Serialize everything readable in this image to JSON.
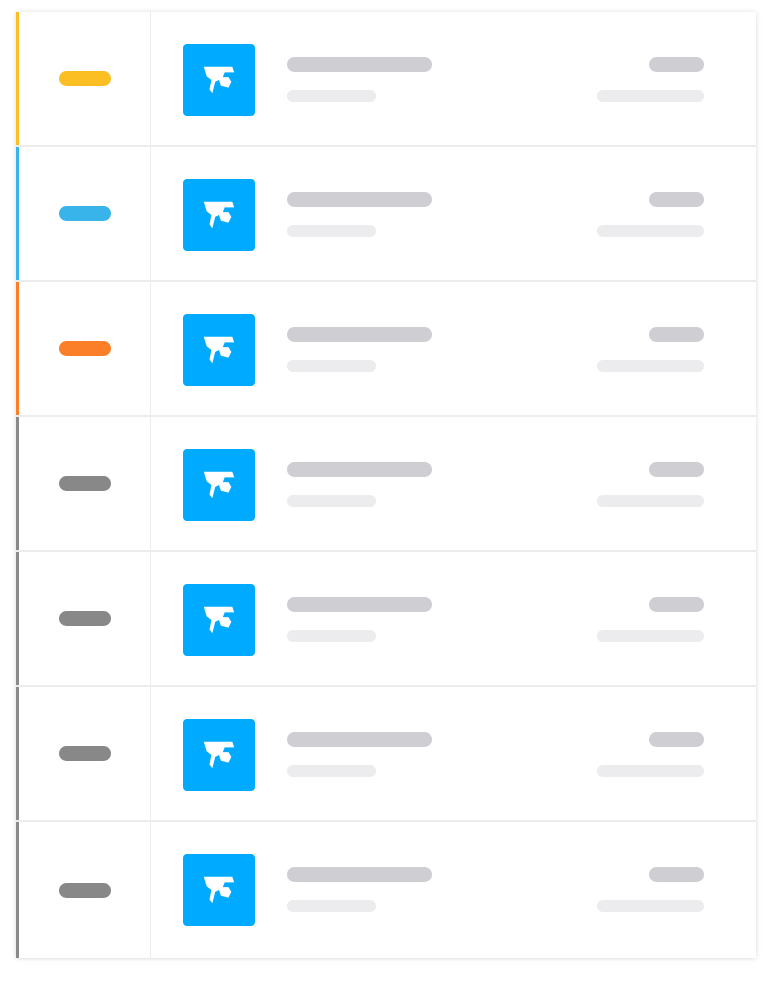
{
  "colors": {
    "icon_background": "#00aaff",
    "icon_glyph": "#ffffff",
    "placeholder_dark": "#cfcfd3",
    "placeholder_light": "#ececee"
  },
  "rows": [
    {
      "status": "yellow",
      "status_color": "#fbbf24",
      "accent_color": "#fbbf24",
      "icon": "app-logo-icon"
    },
    {
      "status": "blue",
      "status_color": "#38b4ea",
      "accent_color": "#38b4ea",
      "icon": "app-logo-icon"
    },
    {
      "status": "orange",
      "status_color": "#fb7e28",
      "accent_color": "#fb7e28",
      "icon": "app-logo-icon"
    },
    {
      "status": "gray",
      "status_color": "#888888",
      "accent_color": "#8a8a8a",
      "icon": "app-logo-icon"
    },
    {
      "status": "gray",
      "status_color": "#888888",
      "accent_color": "#8a8a8a",
      "icon": "app-logo-icon"
    },
    {
      "status": "gray",
      "status_color": "#888888",
      "accent_color": "#8a8a8a",
      "icon": "app-logo-icon"
    },
    {
      "status": "gray",
      "status_color": "#888888",
      "accent_color": "#8a8a8a",
      "icon": "app-logo-icon"
    }
  ]
}
